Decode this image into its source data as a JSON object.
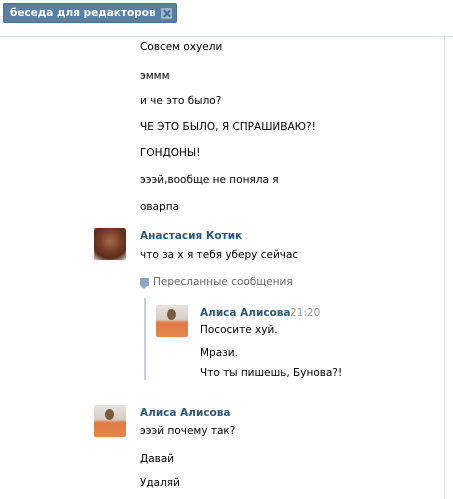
{
  "tab": {
    "label": "беседа для редакторов"
  },
  "messages_top": [
    "Совсем охуели",
    "эммм",
    "и че это было?",
    "ЧЕ ЭТО БЫЛО, Я СПРАШИВАЮ?!",
    "ГОНДОНЫ!",
    "эээй,вообще не поняла я",
    "оварпа"
  ],
  "msg_kotik": {
    "author": "Анастасия Котик",
    "text": "что за х я тебя уберу сейчас"
  },
  "forwarded": {
    "header": "Пересланные сообщения",
    "author": "Алиса Алисова",
    "time": "21:20",
    "lines": [
      "Пососите хуй.",
      "Мрази.",
      "Что ты пишешь, Бунова?!"
    ]
  },
  "msg_alisa": {
    "author": "Алиса Алисова",
    "lines": [
      "эээй почему так?",
      "Давай",
      "Удаляй"
    ]
  }
}
